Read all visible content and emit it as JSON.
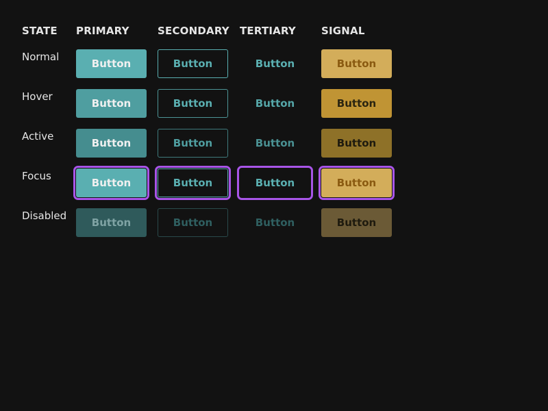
{
  "headers": {
    "state": "STATE",
    "primary": "PRIMARY",
    "secondary": "SECONDARY",
    "tertiary": "TERTIARY",
    "signal": "SIGNAL"
  },
  "states": [
    "Normal",
    "Hover",
    "Active",
    "Focus",
    "Disabled"
  ],
  "button_label": "Button",
  "colors": {
    "background": "#121212",
    "focus_ring": "#a855e8",
    "primary": {
      "normal": {
        "bg": "#5aafb1",
        "fg": "#f0f0f0"
      },
      "hover": {
        "bg": "#4f9ea0",
        "fg": "#f0f0f0"
      },
      "active": {
        "bg": "#458d8f",
        "fg": "#f0f0f0"
      },
      "focus": {
        "bg": "#5aafb1",
        "fg": "#f0f0f0"
      },
      "disabled": {
        "bg": "#2f5a5b",
        "fg": "#7fa3a4"
      }
    },
    "secondary": {
      "normal": {
        "border": "#5aafb1",
        "fg": "#5aafb1"
      },
      "hover": {
        "border": "#4d9597",
        "fg": "#5aafb1"
      },
      "active": {
        "border": "#3f7b7d",
        "fg": "#4f9ea0"
      },
      "focus": {
        "border": "#5aafb1",
        "fg": "#5aafb1"
      },
      "disabled": {
        "border": "#2a4a4b",
        "fg": "#2f5f60"
      }
    },
    "tertiary": {
      "normal": {
        "fg": "#5aafb1"
      },
      "hover": {
        "fg": "#55a6a8"
      },
      "active": {
        "fg": "#4a9193"
      },
      "focus": {
        "fg": "#5aafb1"
      },
      "disabled": {
        "fg": "#2f5f60"
      }
    },
    "signal": {
      "normal": {
        "bg": "#d3ad5a",
        "fg": "#8a5a10"
      },
      "hover": {
        "bg": "#c09434",
        "fg": "#2a2410"
      },
      "active": {
        "bg": "#8e7128",
        "fg": "#1e1a0e"
      },
      "focus": {
        "bg": "#d3ad5a",
        "fg": "#8a5a10"
      },
      "disabled": {
        "bg": "#6b5a36",
        "fg": "#1e1a0e"
      }
    }
  }
}
